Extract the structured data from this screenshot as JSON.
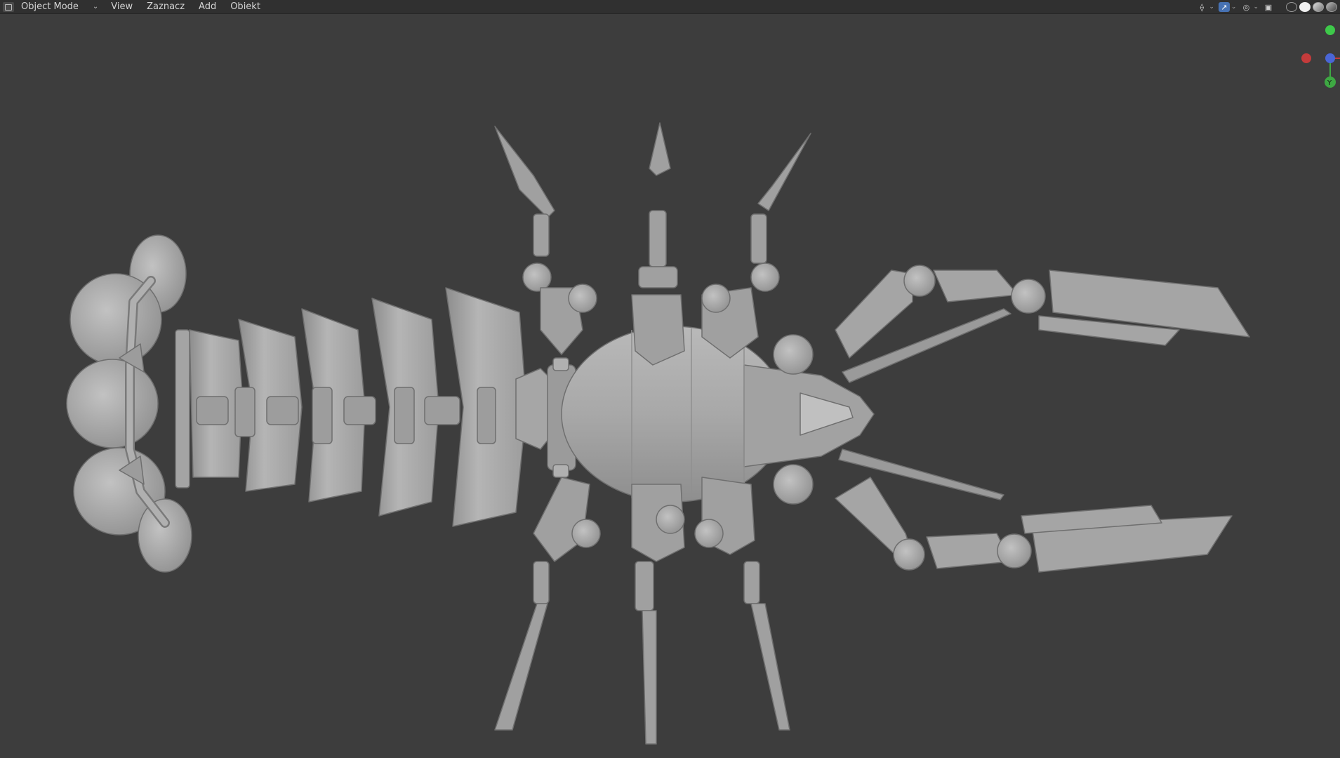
{
  "header": {
    "mode": "Object Mode",
    "menu": [
      "View",
      "Zaznacz",
      "Add",
      "Obiekt"
    ]
  },
  "gizmo": {
    "y_label": "Y",
    "colors": {
      "x": "#c43b3b",
      "y": "#3ea843",
      "z": "#4a66d6"
    }
  },
  "colors": {
    "viewport_bg": "#3d3d3d",
    "header_bg": "#303030",
    "model": "#a9a9a9",
    "accent": "#4772b3"
  }
}
